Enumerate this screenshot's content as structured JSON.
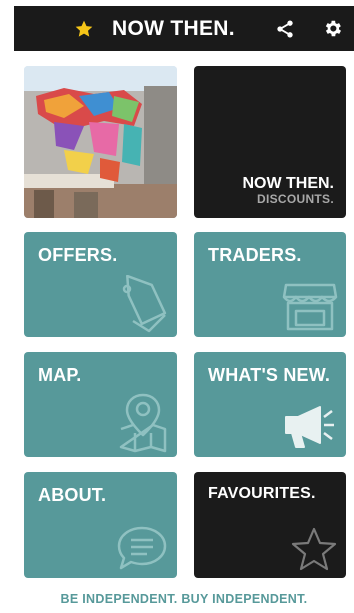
{
  "app": {
    "title": "NOW THEN."
  },
  "header": {
    "star_icon": "star-icon",
    "share_icon": "share-icon",
    "settings_icon": "gear-icon",
    "star_color": "#f5c518"
  },
  "hero": {
    "image": "street-mural-photo",
    "brand_title": "NOW THEN.",
    "brand_subtitle": "DISCOUNTS."
  },
  "tiles": {
    "offers": {
      "label": "OFFERS.",
      "icon": "tag-icon"
    },
    "traders": {
      "label": "TRADERS.",
      "icon": "storefront-icon"
    },
    "map": {
      "label": "MAP.",
      "icon": "map-pin-icon"
    },
    "whats_new": {
      "label": "WHAT'S NEW.",
      "icon": "megaphone-icon"
    },
    "about": {
      "label": "ABOUT.",
      "icon": "speech-bubble-icon"
    },
    "favourites": {
      "label": "FAVOURITES.",
      "icon": "star-outline-icon"
    }
  },
  "footer": {
    "tagline": "BE INDEPENDENT. BUY INDEPENDENT."
  },
  "colors": {
    "teal": "#57999a",
    "dark": "#1b1b1b",
    "topbar": "#1a1a1a"
  }
}
